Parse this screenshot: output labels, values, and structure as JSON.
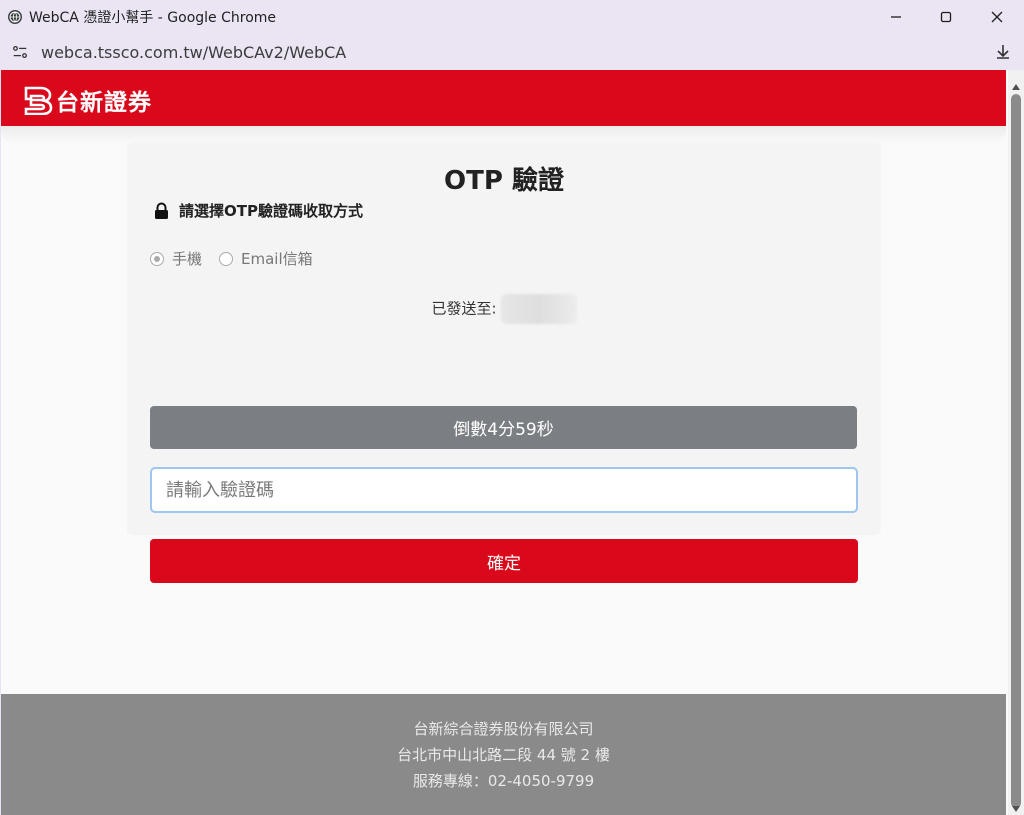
{
  "window": {
    "title": "WebCA 憑證小幫手 - Google Chrome",
    "url": "webca.tssco.com.tw/WebCAv2/WebCA"
  },
  "header": {
    "brand": "台新證券",
    "brand_color": "#d9091b"
  },
  "form": {
    "title": "OTP 驗證",
    "subtitle": "請選擇OTP驗證碼收取方式",
    "options": [
      {
        "label": "手機",
        "selected": true
      },
      {
        "label": "Email信箱",
        "selected": false
      }
    ],
    "sent_to_label": "已發送至:",
    "countdown": "倒數4分59秒",
    "otp_placeholder": "請輸入驗證碼",
    "confirm_label": "確定"
  },
  "footer": {
    "company": "台新綜合證券股份有限公司",
    "address": "台北市中山北路二段 44 號 2 樓",
    "hotline": "服務專線：02-4050-9799"
  },
  "icons": [
    "globe-icon",
    "minimize-icon",
    "maximize-icon",
    "close-icon",
    "site-settings-icon",
    "download-icon",
    "lock-icon"
  ]
}
